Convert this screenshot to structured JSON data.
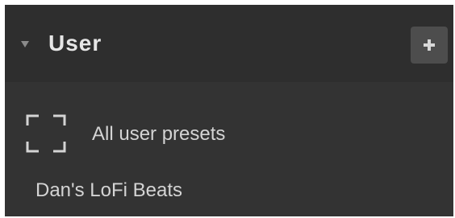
{
  "section": {
    "title": "User",
    "collapse_icon": "chevron-down-icon",
    "add_icon": "plus-icon"
  },
  "all_presets": {
    "label": "All user presets",
    "icon": "select-all-icon"
  },
  "presets": [
    {
      "label": "Dan's LoFi Beats"
    }
  ],
  "colors": {
    "panel_bg": "#333333",
    "header_bg": "#2e2e2e",
    "button_bg": "#4d4d4d",
    "text": "#d4d4d4",
    "title_text": "#e6e6e6"
  }
}
